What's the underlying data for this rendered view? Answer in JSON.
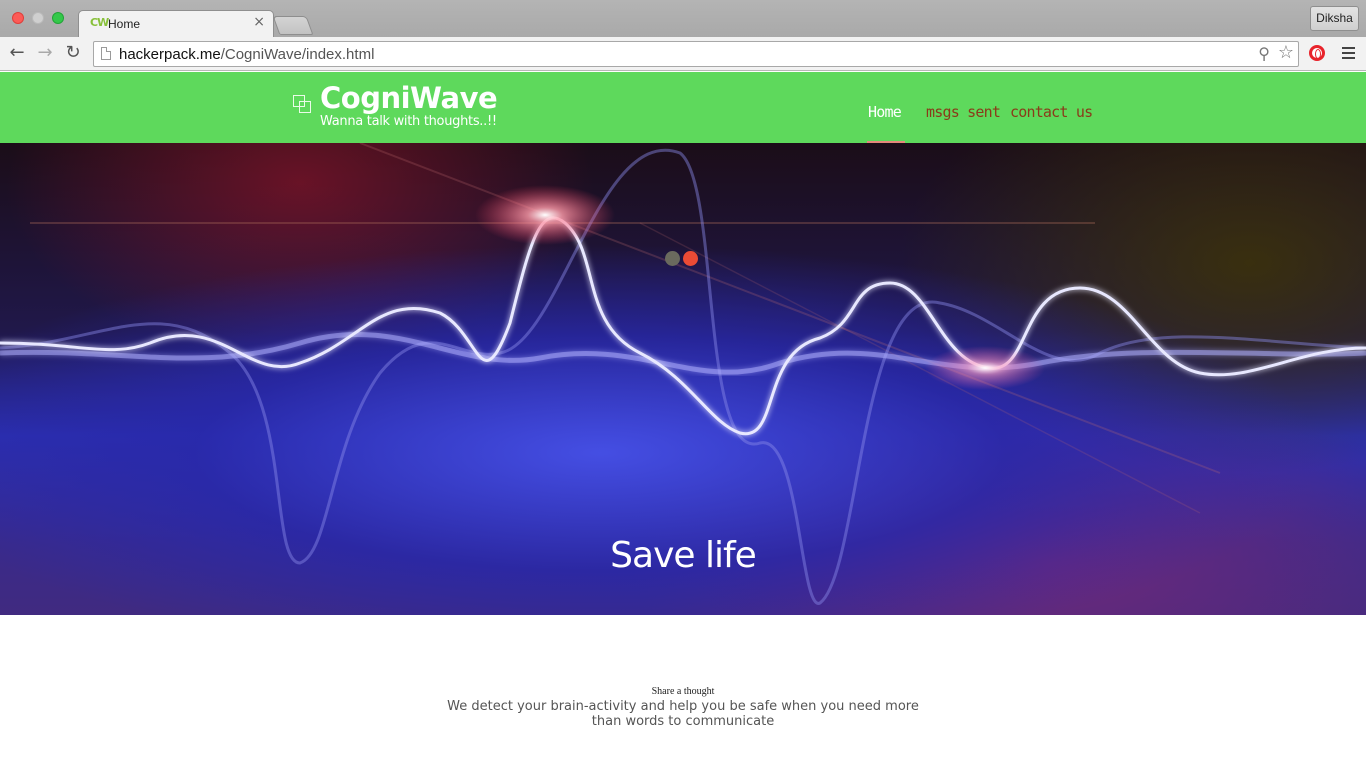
{
  "browser": {
    "tab": {
      "title": "Home",
      "favicon_text": "CW",
      "close_glyph": "×"
    },
    "profile_name": "Diksha",
    "url": {
      "host": "hackerpack.me",
      "path": "/CogniWave/index.html"
    },
    "icons": [
      "back-arrow-icon",
      "forward-arrow-icon",
      "reload-icon",
      "page-icon",
      "zoom-icon",
      "star-icon",
      "opera-icon",
      "menu-icon"
    ],
    "colors": {
      "close_red": "#fc5b57",
      "maximize_green": "#34c84a"
    }
  },
  "site": {
    "brand": {
      "title": "CogniWave",
      "tagline": "Wanna talk with thoughts..!!"
    },
    "nav": [
      {
        "label": "Home",
        "active": true
      },
      {
        "label": "msgs sent",
        "active": false
      },
      {
        "label": "contact us",
        "active": false
      }
    ],
    "hero": {
      "caption": "Save life",
      "slides_total": 2,
      "active_slide": 2
    },
    "intro": {
      "title": "Share a thought",
      "text": "We detect your brain-activity and help you be safe when you need more than words to communicate"
    },
    "colors": {
      "header_green": "#5ed95c",
      "nav_link": "#8a3b1a",
      "active_dot": "#ea4b35",
      "inactive_dot": "#6a6a5e"
    }
  }
}
